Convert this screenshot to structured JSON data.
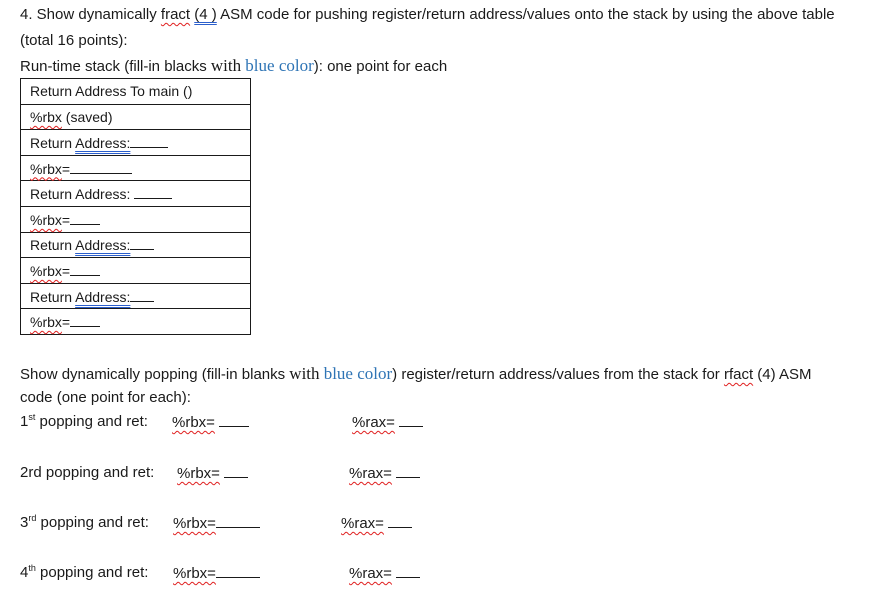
{
  "question": {
    "line1_prefix": "4. Show dynamically ",
    "line1_fract": "fract",
    "line1_arg": "(4 )",
    "line1_suffix": " ASM code for pushing register/return address/values onto the stack by using the above table",
    "line2": "(total 16 points):",
    "line3_prefix": "Run-time stack (fill-in blacks ",
    "line3_with": "with",
    "line3_blue": "blue color",
    "line3_suffix": "): one point for each"
  },
  "stack_table": {
    "rows": [
      {
        "label": "Return Address To main ()",
        "blank": false
      },
      {
        "label_reg": "%rbx",
        "label_rest": " (saved)",
        "blank": false
      },
      {
        "label": "Return Address:",
        "blank": true
      },
      {
        "label_reg": "%rbx",
        "label_rest": "=",
        "blank": true
      },
      {
        "label": "Return Address:",
        "blank": true
      },
      {
        "label_reg": "%rbx",
        "label_rest": "=",
        "blank": true
      },
      {
        "label": "Return Address:",
        "blank": true
      },
      {
        "label_reg": "%rbx",
        "label_rest": "=",
        "blank": true
      },
      {
        "label": "Return Address:",
        "blank": true
      },
      {
        "label_reg": "%rbx",
        "label_rest": "=",
        "blank": true
      }
    ],
    "return_word": "Return ",
    "address_word": "Address:"
  },
  "popping": {
    "intro_prefix": "Show dynamically popping (fill-in blanks ",
    "intro_with": "with",
    "intro_blue": "blue color",
    "intro_mid": ") register/return address/values from the stack for ",
    "intro_rfact": "rfact",
    "intro_suffix": " (4) ASM",
    "intro_line2": "code (one point for each):",
    "rows": [
      {
        "num": "1",
        "sup": "st",
        "label": " popping and ret:",
        "rbx": "%rbx=",
        "rax": "%rax="
      },
      {
        "num": "2rd",
        "sup": "",
        "label": " popping and ret:",
        "rbx": "%rbx=",
        "rax": "%rax="
      },
      {
        "num": "3",
        "sup": "rd",
        "label": " popping and ret:",
        "rbx": "%rbx=",
        "rax": "%rax="
      },
      {
        "num": "4",
        "sup": "th",
        "label": " popping and ret:",
        "rbx": "%rbx=",
        "rax": "%rax="
      }
    ]
  },
  "colors": {
    "blue_text": "#2e74b5",
    "spellcheck_red": "#e02020",
    "grammar_blue": "#2b5fcc"
  }
}
